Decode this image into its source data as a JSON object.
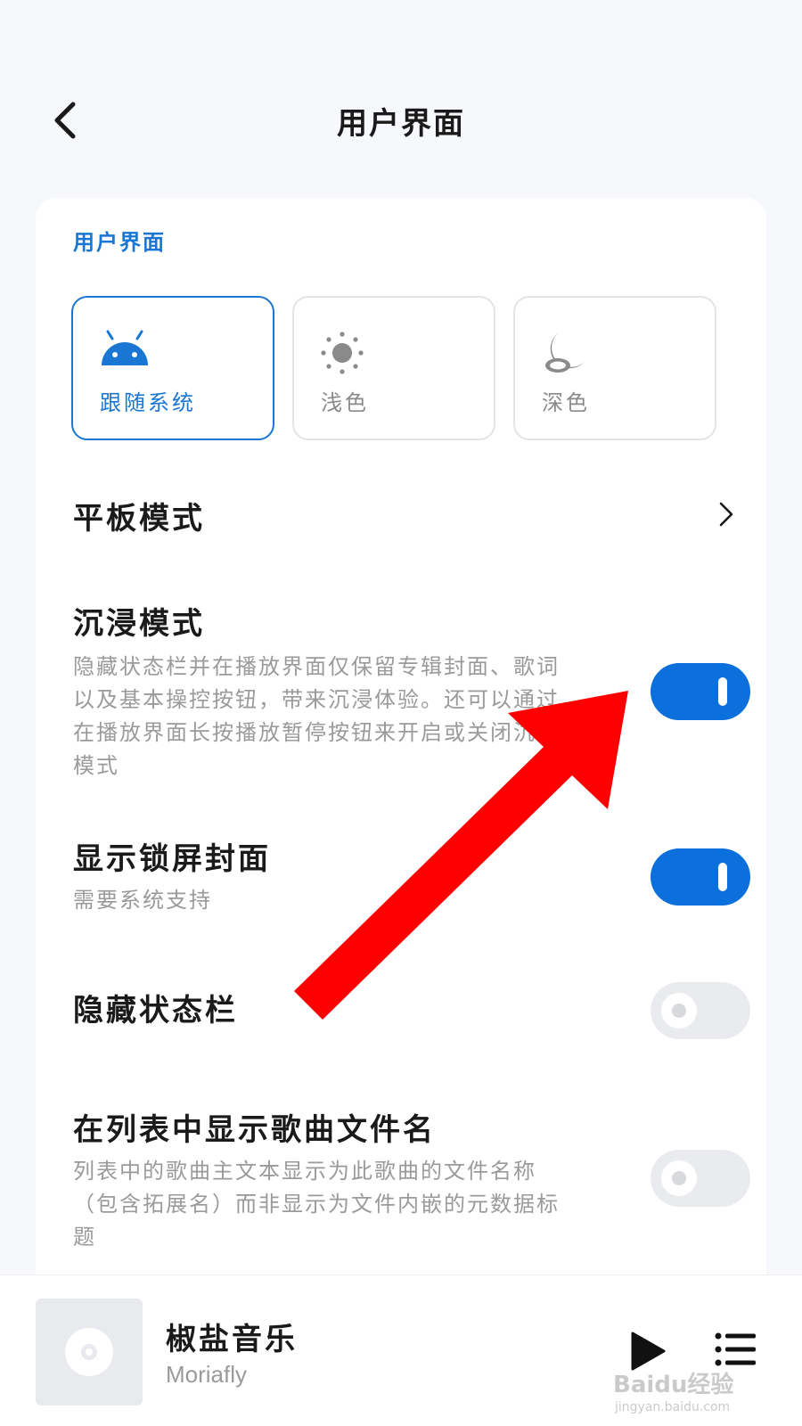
{
  "header": {
    "title": "用户界面"
  },
  "section": {
    "title": "用户界面"
  },
  "theme_options": [
    {
      "label": "跟随系统",
      "icon": "android-icon",
      "selected": true
    },
    {
      "label": "浅色",
      "icon": "sun-icon",
      "selected": false
    },
    {
      "label": "深色",
      "icon": "moon-icon",
      "selected": false
    }
  ],
  "settings": {
    "tablet": {
      "title": "平板模式"
    },
    "immersive": {
      "title": "沉浸模式",
      "description": "隐藏状态栏并在播放界面仅保留专辑封面、歌词以及基本操控按钮，带来沉浸体验。还可以通过在播放界面长按播放暂停按钮来开启或关闭沉浸模式",
      "enabled": true
    },
    "lockscreen_cover": {
      "title": "显示锁屏封面",
      "description": "需要系统支持",
      "enabled": true
    },
    "hide_statusbar": {
      "title": "隐藏状态栏",
      "enabled": false
    },
    "show_filename": {
      "title": "在列表中显示歌曲文件名",
      "description": "列表中的歌曲主文本显示为此歌曲的文件名称（包含拓展名）而非显示为文件内嵌的元数据标题",
      "enabled": false
    }
  },
  "player": {
    "title": "椒盐音乐",
    "artist": "Moriafly"
  },
  "watermark": {
    "text": "Baidu经验",
    "sub": "jingyan.baidu.com"
  },
  "colors": {
    "accent": "#1976d2",
    "toggle_on": "#0b6fdc",
    "annotation_arrow": "#ff0000"
  }
}
